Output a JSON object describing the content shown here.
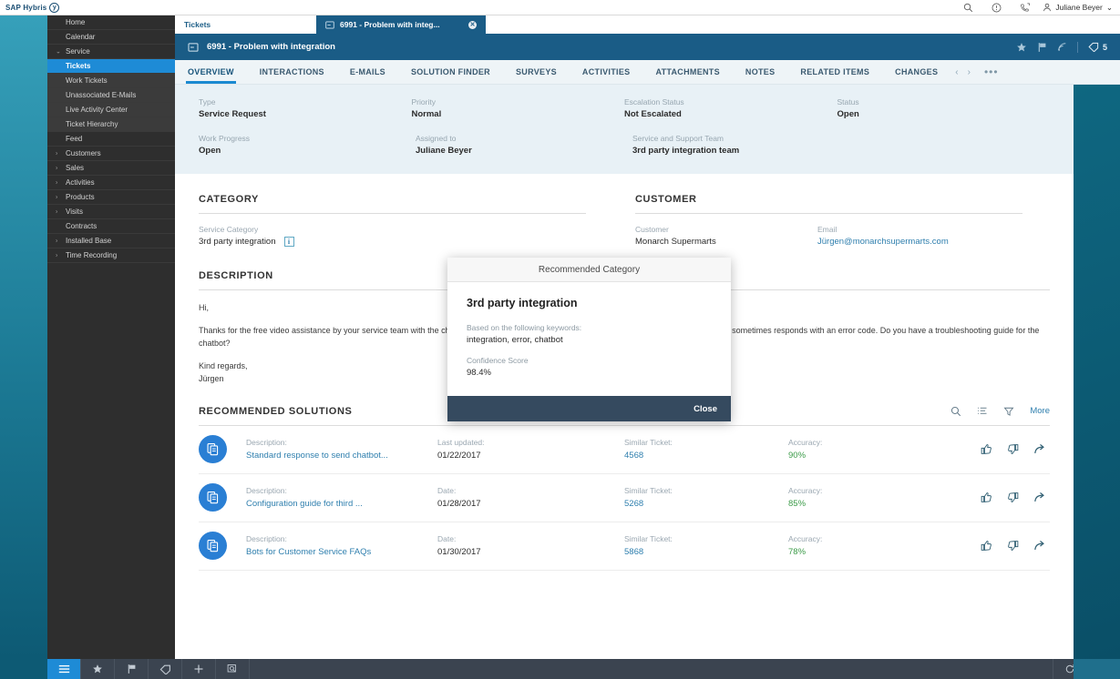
{
  "topbar": {
    "brand": "SAP Hybris",
    "brand_badge": "y",
    "icons": [
      "search-icon",
      "info-icon",
      "callback-icon"
    ],
    "user": "Juliane Beyer",
    "user_chevron": "⌄"
  },
  "sidebar": {
    "items": [
      {
        "label": "Home",
        "level": "top",
        "expandable": false,
        "active": false
      },
      {
        "label": "Calendar",
        "level": "top",
        "expandable": false,
        "active": false
      },
      {
        "label": "Service",
        "level": "top",
        "expandable": true,
        "expanded": true,
        "active": false
      },
      {
        "label": "Tickets",
        "level": "sub",
        "expandable": false,
        "active": true
      },
      {
        "label": "Work Tickets",
        "level": "sub",
        "expandable": false,
        "active": false
      },
      {
        "label": "Unassociated E-Mails",
        "level": "sub",
        "expandable": false,
        "active": false
      },
      {
        "label": "Live Activity Center",
        "level": "sub",
        "expandable": false,
        "active": false
      },
      {
        "label": "Ticket Hierarchy",
        "level": "sub",
        "expandable": false,
        "active": false
      },
      {
        "label": "Feed",
        "level": "top",
        "expandable": false,
        "active": false
      },
      {
        "label": "Customers",
        "level": "top",
        "expandable": true,
        "expanded": false,
        "active": false
      },
      {
        "label": "Sales",
        "level": "top",
        "expandable": true,
        "expanded": false,
        "active": false
      },
      {
        "label": "Activities",
        "level": "top",
        "expandable": true,
        "expanded": false,
        "active": false
      },
      {
        "label": "Products",
        "level": "top",
        "expandable": true,
        "expanded": false,
        "active": false
      },
      {
        "label": "Visits",
        "level": "top",
        "expandable": true,
        "expanded": false,
        "active": false
      },
      {
        "label": "Contracts",
        "level": "top",
        "expandable": false,
        "active": false
      },
      {
        "label": "Installed Base",
        "level": "top",
        "expandable": true,
        "expanded": false,
        "active": false
      },
      {
        "label": "Time Recording",
        "level": "top",
        "expandable": true,
        "expanded": false,
        "active": false
      }
    ]
  },
  "workspace_tabs": {
    "list_tab": "Tickets",
    "active_tab": "6991 - Problem with integ...",
    "close": "✕"
  },
  "ticket_header": {
    "title": "6991 - Problem with integration",
    "icons": [
      "star-icon",
      "flag-icon",
      "feed-icon"
    ],
    "tag_count": "5"
  },
  "nav_tabs": {
    "items": [
      {
        "label": "OVERVIEW",
        "active": true
      },
      {
        "label": "INTERACTIONS",
        "active": false
      },
      {
        "label": "E-MAILS",
        "active": false
      },
      {
        "label": "SOLUTION FINDER",
        "active": false
      },
      {
        "label": "SURVEYS",
        "active": false
      },
      {
        "label": "ACTIVITIES",
        "active": false
      },
      {
        "label": "ATTACHMENTS",
        "active": false
      },
      {
        "label": "NOTES",
        "active": false
      },
      {
        "label": "RELATED ITEMS",
        "active": false
      },
      {
        "label": "CHANGES",
        "active": false
      }
    ],
    "prev": "‹",
    "next": "›",
    "overflow": "•••"
  },
  "facts": [
    {
      "label": "Type",
      "value": "Service Request"
    },
    {
      "label": "Priority",
      "value": "Normal"
    },
    {
      "label": "Escalation Status",
      "value": "Not Escalated"
    },
    {
      "label": "Status",
      "value": "Open"
    },
    {
      "label": "Work Progress",
      "value": "Open"
    },
    {
      "label": "Assigned to",
      "value": "Juliane Beyer"
    },
    {
      "label": "Service and Support Team",
      "value": "3rd party integration team"
    }
  ],
  "category_section": {
    "title": "CATEGORY",
    "service_category_label": "Service Category",
    "service_category_value": "3rd party integration",
    "info_glyph": "i"
  },
  "customer_section": {
    "title": "CUSTOMER",
    "customer_label": "Customer",
    "customer_value": "Monarch Supermarts",
    "email_label": "Email",
    "email_value": "Jürgen@monarchsupermarts.com"
  },
  "description": {
    "title": "DESCRIPTION",
    "greeting": "Hi,",
    "body": "Thanks for the free video assistance by your service team with the chatbot integration. We are successfully parsing the user input, but the program sometimes responds with an error code. Do you have a troubleshooting guide for the chatbot?",
    "signoff": "Kind regards,",
    "signature": "Jürgen"
  },
  "recommended_solutions": {
    "title": "RECOMMENDED SOLUTIONS",
    "more": "More",
    "toolbar_icons": [
      "search-icon",
      "sort-icon",
      "filter-icon"
    ],
    "rows": [
      {
        "description_label": "Description:",
        "description_value": "Standard response to send chatbot...",
        "date_label": "Last updated:",
        "date_value": "01/22/2017",
        "ticket_label": "Similar Ticket:",
        "ticket_value": "4568",
        "accuracy_label": "Accuracy:",
        "accuracy_value": "90%"
      },
      {
        "description_label": "Description:",
        "description_value": "Configuration guide for third ...",
        "date_label": "Date:",
        "date_value": "01/28/2017",
        "ticket_label": "Similar Ticket:",
        "ticket_value": "5268",
        "accuracy_label": "Accuracy:",
        "accuracy_value": "85%"
      },
      {
        "description_label": "Description:",
        "description_value": "Bots for Customer Service FAQs",
        "date_label": "Date:",
        "date_value": "01/30/2017",
        "ticket_label": "Similar Ticket:",
        "ticket_value": "5868",
        "accuracy_label": "Accuracy:",
        "accuracy_value": "78%"
      }
    ]
  },
  "modal": {
    "title": "Recommended Category",
    "heading": "3rd party integration",
    "keywords_label": "Based on the following keywords:",
    "keywords_value": "integration, error, chatbot",
    "confidence_label": "Confidence Score",
    "confidence_value": "98.4%",
    "close_label": "Close"
  },
  "bottom_bar": {
    "left_icons": [
      "menu-icon",
      "star-icon",
      "flag-icon",
      "tag-icon",
      "plus-icon",
      "search-doc-icon"
    ],
    "right_icons": [
      "refresh-icon",
      "overflow-icon"
    ]
  },
  "colors": {
    "accent_blue": "#1e8bd6",
    "header_blue": "#1a5c86",
    "link_blue": "#2f7fae",
    "success_green": "#3d9c4a",
    "modal_footer": "#354a5f"
  }
}
